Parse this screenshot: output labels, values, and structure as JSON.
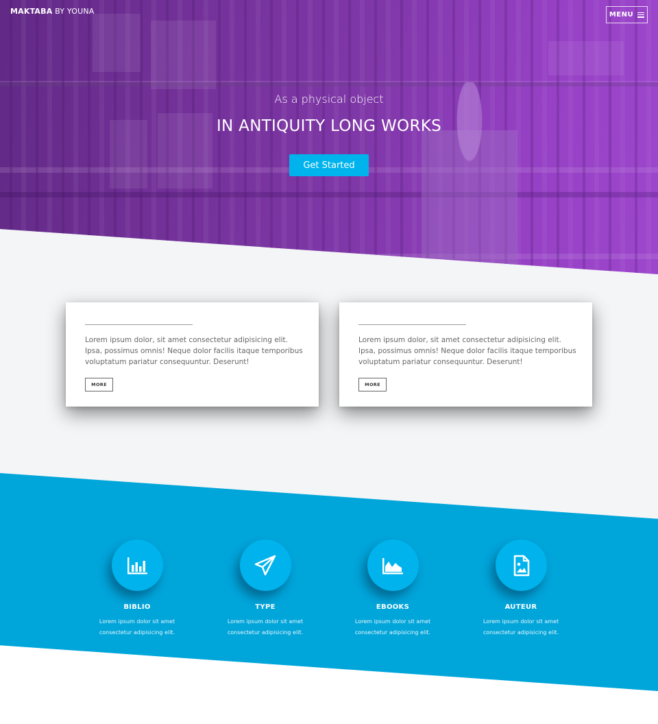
{
  "nav": {
    "brand_bold": "MAKTABA",
    "brand_rest": " BY YOUNA",
    "menu_label": "MENU"
  },
  "hero": {
    "subtitle": "As a physical object",
    "title": "IN ANTIQUITY LONG WORKS",
    "cta_label": "Get Started"
  },
  "cards": [
    {
      "text": "Lorem ipsum dolor, sit amet consectetur adipisicing elit. Ipsa, possimus omnis! Neque dolor facilis itaque temporibus voluptatum pariatur consequuntur. Deserunt!",
      "button": "MORE"
    },
    {
      "text": "Lorem ipsum dolor, sit amet consectetur adipisicing elit. Ipsa, possimus omnis! Neque dolor facilis itaque temporibus voluptatum pariatur consequuntur. Deserunt!",
      "button": "MORE"
    }
  ],
  "features": [
    {
      "icon": "bar-chart-icon",
      "title": "BIBLIO",
      "desc": "Lorem ipsum dolor sit amet consectetur adipisicing elit."
    },
    {
      "icon": "paper-plane-icon",
      "title": "TYPE",
      "desc": "Lorem ipsum dolor sit amet consectetur adipisicing elit."
    },
    {
      "icon": "area-chart-icon",
      "title": "EBOOKS",
      "desc": "Lorem ipsum dolor sit amet consectetur adipisicing elit."
    },
    {
      "icon": "file-image-icon",
      "title": "AUTEUR",
      "desc": "Lorem ipsum dolor sit amet consectetur adipisicing elit."
    }
  ],
  "colors": {
    "hero_purple": "#7b3aa0",
    "accent_blue": "#00b3ec",
    "section_blue": "#00a5da",
    "gray_bg": "#f3f5f6"
  }
}
